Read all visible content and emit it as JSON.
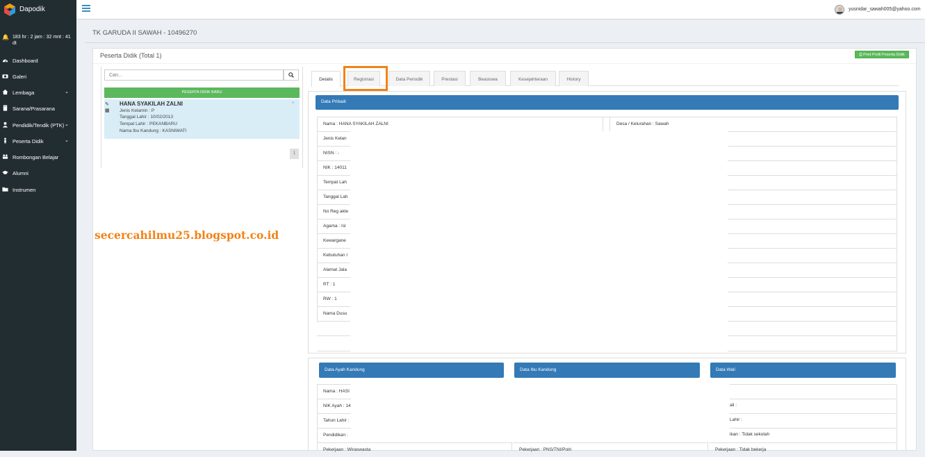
{
  "app": {
    "name": "Dapodik"
  },
  "session_timer": "183 hr : 2 jam : 32 mnt : 41 dt",
  "sidebar": {
    "items": [
      {
        "label": "Dashboard",
        "icon": "dashboard-icon"
      },
      {
        "label": "Galeri",
        "icon": "camera-icon"
      },
      {
        "label": "Lembaga",
        "icon": "home-icon",
        "expandable": true
      },
      {
        "label": "Sarana/Prasarana",
        "icon": "building-icon"
      },
      {
        "label": "Pendidik/Tendik (PTK)",
        "icon": "user-icon",
        "expandable": true
      },
      {
        "label": "Peserta Didik",
        "icon": "child-icon",
        "expandable": true
      },
      {
        "label": "Rombongan Belajar",
        "icon": "users-icon"
      },
      {
        "label": "Alumni",
        "icon": "graduation-cap-icon"
      },
      {
        "label": "Instrumen",
        "icon": "folder-icon"
      }
    ]
  },
  "header": {
    "user_email": "yusnidar_sawah005@yahoo.com"
  },
  "school_title": "TK GARUDA II SAWAH - 10496270",
  "panel": {
    "title": "Peserta Didik (Total 1)",
    "print_button": "Print Profil Peserta Didik"
  },
  "search": {
    "placeholder": "Cari..."
  },
  "new_student_button": "PESERTA DIDIK BARU",
  "student": {
    "name": "HANA SYAKILAH ZALNI",
    "lines": [
      "Jenis Kelamin : P",
      "Tanggal Lahir : 10/02/2013",
      "Tempat Lahir : PEKANBARU",
      "Nama Ibu Kandung : KASNIWATI"
    ]
  },
  "pagination": {
    "current": "1"
  },
  "watermark": "secercahilmu25.blogspot.co.id",
  "tabs": [
    "Detalis",
    "Registrasi",
    "Data Periodik",
    "Prestasi",
    "Beasiswa",
    "Kesejahteraan",
    "History"
  ],
  "data_pribadi": {
    "header": "Data Pribadi",
    "left_rows": [
      "Nama : HANA SYAKILAH ZALNI",
      "Jenis Kelan",
      "NISN : -",
      "NIK : 14011",
      "Tempat Lah",
      "Tanggal Lah",
      "No Reg akte",
      "Agama : Isl",
      "Kewargane",
      "Kebutuhan I",
      "Alamat Jala",
      "RT : 1",
      "RW : 1",
      "Nama Dusu"
    ],
    "right_rows": [
      "Desa / Kelurahan : Sawah"
    ]
  },
  "parents": {
    "ayah": {
      "header": "Data Ayah Kandung",
      "rows": [
        "Nama : HASI",
        "NIK Ayah : 14",
        "Tahun Lahir :",
        "Pendidikan :",
        "Pekerjaan : Wiraswasta"
      ]
    },
    "ibu": {
      "header": "Data Ibu Kandung",
      "rows": [
        "Pekerjaan : PNS/TNI/Polri"
      ]
    },
    "wali": {
      "header": "Data Wali",
      "rows": [
        "ali :",
        "Lahir :",
        "ikan : Tidak sekolah",
        "Pekerjaan : Tidak bekerja"
      ]
    }
  }
}
